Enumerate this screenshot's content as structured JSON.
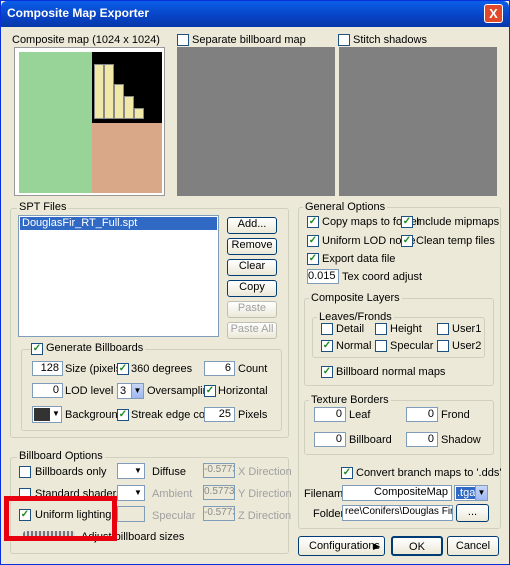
{
  "window": {
    "title": "Composite Map Exporter",
    "close": "X"
  },
  "maps": {
    "composite_label": "Composite map (1024 x 1024)",
    "separate_label": "Separate billboard map",
    "stitch_label": "Stitch shadows"
  },
  "spt": {
    "group": "SPT Files",
    "file": "DouglasFir_RT_Full.spt",
    "add": "Add...",
    "remove": "Remove",
    "clear": "Clear",
    "copy": "Copy",
    "paste": "Paste",
    "paste_all": "Paste All"
  },
  "billboards": {
    "generate": "Generate Billboards",
    "size_value": "128",
    "size_label": "Size (pixels)",
    "degrees": "360 degrees",
    "count_value": "6",
    "count_label": "Count",
    "lod_value": "0",
    "lod_label": "LOD level",
    "oversampling_value": "3",
    "oversampling_label": "Oversampling",
    "horizontal": "Horizontal",
    "background": "Background",
    "streak": "Streak edge colors",
    "pixels_value": "25",
    "pixels_label": "Pixels"
  },
  "billboard_options": {
    "group": "Billboard Options",
    "only": "Billboards only",
    "standard_shaders": "Standard shaders",
    "uniform_lighting": "Uniform lighting",
    "adjust_sizes": "Adjust billboard sizes",
    "diffuse": "Diffuse",
    "ambient": "Ambient",
    "specular": "Specular",
    "x_val": "-0.5773",
    "y_val": "0.5773",
    "z_val": "-0.5773",
    "x_dir": "X Direction",
    "y_dir": "Y Direction",
    "z_dir": "Z Direction"
  },
  "general": {
    "group": "General Options",
    "copy_maps": "Copy maps to folder",
    "include_mipmaps": "Include mipmaps",
    "uniform_lod": "Uniform LOD noise",
    "clean_temp": "Clean temp files",
    "export_data": "Export data file",
    "tex_value": "0.015",
    "tex_label": "Tex coord adjust"
  },
  "layers": {
    "group": "Composite Layers",
    "leaves": "Leaves/Fronds",
    "detail": "Detail",
    "height": "Height",
    "user1": "User1",
    "normal": "Normal",
    "specular": "Specular",
    "user2": "User2",
    "bb_normal": "Billboard normal maps"
  },
  "borders": {
    "group": "Texture Borders",
    "leaf_value": "0",
    "leaf": "Leaf",
    "frond_value": "0",
    "frond": "Frond",
    "billboard_value": "0",
    "billboard": "Billboard",
    "shadow_value": "0",
    "shadow": "Shadow"
  },
  "output": {
    "convert": "Convert branch maps to '.dds'",
    "filename_label": "Filename",
    "filename_value": "CompositeMap",
    "ext": ".tga",
    "folder_label": "Folder",
    "folder_value": "ree\\Conifers\\Douglas Fir Full",
    "browse": "..."
  },
  "footer": {
    "configurations": "Configurations",
    "arrow": "▶",
    "ok": "OK",
    "cancel": "Cancel"
  },
  "colors": {
    "highlight": "#e8000f",
    "selection": "#316ac5"
  }
}
